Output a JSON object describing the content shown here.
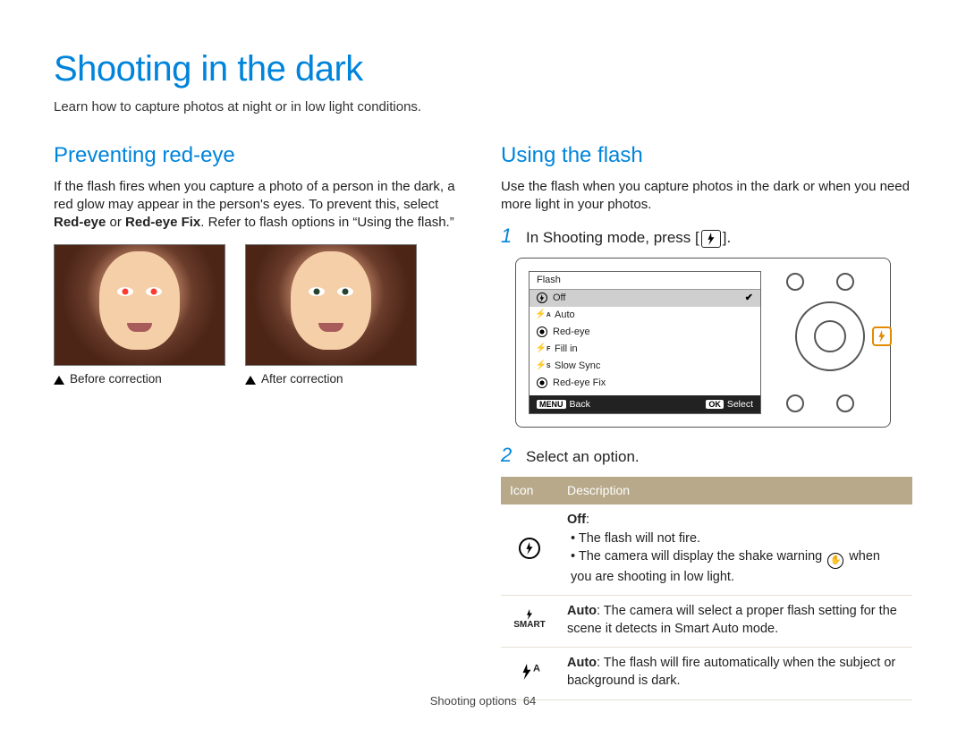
{
  "page": {
    "title": "Shooting in the dark",
    "intro": "Learn how to capture photos at night or in low light conditions."
  },
  "left": {
    "heading": "Preventing red-eye",
    "para_pre": "If the flash fires when you capture a photo of a person in the dark, a red glow may appear in the person's eyes. To prevent this, select ",
    "bold1": "Red-eye",
    "para_mid": " or ",
    "bold2": "Red-eye Fix",
    "para_post": ". Refer to flash options in “Using the flash.”",
    "caption_before": "Before correction",
    "caption_after": "After correction"
  },
  "right": {
    "heading": "Using the flash",
    "intro": "Use the flash when you capture photos in the dark or when you need more light in your photos.",
    "step1_pre": "In Shooting mode, press [",
    "step1_post": "].",
    "step2": "Select an option.",
    "step_num1": "1",
    "step_num2": "2"
  },
  "camera": {
    "menu_title": "Flash",
    "items": [
      {
        "label": "Off",
        "selected": true,
        "iconName": "flash-off-icon"
      },
      {
        "label": "Auto",
        "selected": false,
        "iconName": "flash-auto-icon"
      },
      {
        "label": "Red-eye",
        "selected": false,
        "iconName": "red-eye-icon"
      },
      {
        "label": "Fill in",
        "selected": false,
        "iconName": "fill-in-icon"
      },
      {
        "label": "Slow Sync",
        "selected": false,
        "iconName": "slow-sync-icon"
      },
      {
        "label": "Red-eye Fix",
        "selected": false,
        "iconName": "red-eye-fix-icon"
      }
    ],
    "footer_left_pill": "MENU",
    "footer_left_label": "Back",
    "footer_right_pill": "OK",
    "footer_right_label": "Select"
  },
  "table": {
    "hdr_icon": "Icon",
    "hdr_desc": "Description",
    "row_off": {
      "title": "Off",
      "b1": "The flash will not fire.",
      "b2_pre": "The camera will display the shake warning ",
      "b2_post": " when you are shooting in low light."
    },
    "row_smart": {
      "title": "Auto",
      "text": ": The camera will select a proper flash setting for the scene it detects in Smart Auto mode.",
      "smart_label": "SMART"
    },
    "row_auto": {
      "title": "Auto",
      "text": ": The flash will fire automatically when the subject or background is dark.",
      "sup": "A"
    }
  },
  "footer": {
    "section": "Shooting options",
    "page_no": "64"
  },
  "icons": {
    "bolt": "⚡",
    "eye": "◉",
    "hand": "✋",
    "check": "✔"
  }
}
